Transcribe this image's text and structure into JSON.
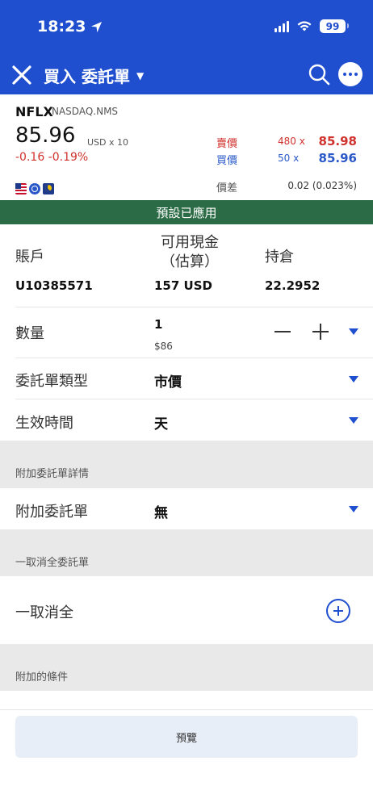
{
  "status_bar": {
    "time": "18:23",
    "battery": "99"
  },
  "header": {
    "title": "買入 委託單"
  },
  "quote": {
    "symbol": "NFLX",
    "exchange": "NASDAQ.NMS",
    "last": "85.96",
    "unit": "USD x 10",
    "change": "-0.16  -0.19%",
    "ask": {
      "label": "賣價",
      "qty": "480 x",
      "price": "85.98"
    },
    "bid": {
      "label": "買價",
      "qty": "50 x",
      "price": "85.96"
    },
    "spread_label": "價差",
    "spread_value": "0.02 (0.023%)"
  },
  "banner": "預設已應用",
  "account": {
    "account_label": "賬戶",
    "account_value": "U10385571",
    "cash_label": "可用現金（估算）",
    "cash_value": "157 USD",
    "position_label": "持倉",
    "position_value": "22.2952"
  },
  "quantity": {
    "label": "數量",
    "value": "1",
    "sub": "$86"
  },
  "order_type": {
    "label": "委託單類型",
    "value": "市價"
  },
  "tif": {
    "label": "生效時間",
    "value": "天"
  },
  "attached": {
    "section": "附加委託單詳情",
    "label": "附加委託單",
    "value": "無"
  },
  "oca": {
    "section": "一取消全委託單",
    "label": "一取消全"
  },
  "conditions": {
    "section": "附加的條件"
  },
  "preview_button": "預覽",
  "colors": {
    "brand": "#1f4fcf",
    "banner": "#2b6b45",
    "down": "#d0312d",
    "bid": "#2a58c8"
  }
}
